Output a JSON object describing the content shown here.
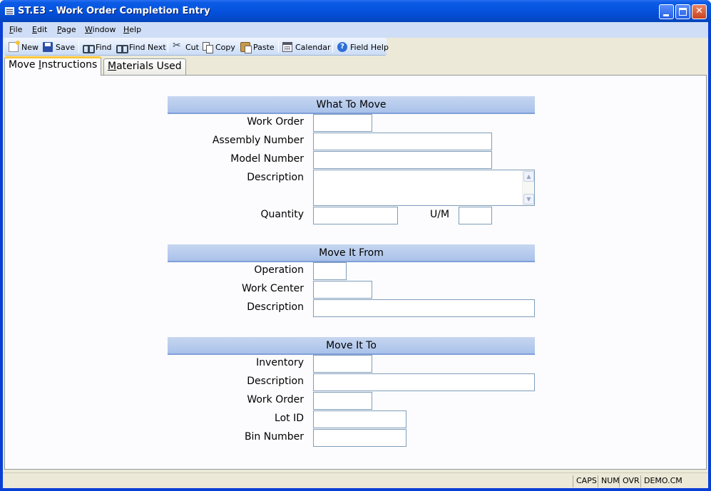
{
  "window": {
    "title": "ST.E3 - Work Order Completion Entry"
  },
  "menu": {
    "items": [
      "File",
      "Edit",
      "Page",
      "Window",
      "Help"
    ]
  },
  "toolbar": {
    "new": "New",
    "save": "Save",
    "find": "Find",
    "find_next": "Find Next",
    "cut": "Cut",
    "copy": "Copy",
    "paste": "Paste",
    "calendar": "Calendar",
    "field_help": "Field Help"
  },
  "tabs": {
    "move_instructions": {
      "pre": "Move ",
      "acc": "I",
      "post": "nstructions"
    },
    "materials_used": {
      "pre": "",
      "acc": "M",
      "post": "aterials Used"
    }
  },
  "what_to_move": {
    "header": "What To Move",
    "work_order": {
      "label": "Work Order",
      "value": ""
    },
    "assembly_number": {
      "label": "Assembly Number",
      "value": ""
    },
    "model_number": {
      "label": "Model Number",
      "value": ""
    },
    "description": {
      "label": "Description",
      "value": ""
    },
    "quantity": {
      "label": "Quantity",
      "value": ""
    },
    "um": {
      "label": "U/M",
      "value": ""
    }
  },
  "move_it_from": {
    "header": "Move It From",
    "operation": {
      "label": "Operation",
      "value": ""
    },
    "work_center": {
      "label": "Work Center",
      "value": ""
    },
    "description": {
      "label": "Description",
      "value": ""
    }
  },
  "move_it_to": {
    "header": "Move It To",
    "inventory": {
      "label": "Inventory",
      "value": ""
    },
    "description": {
      "label": "Description",
      "value": ""
    },
    "work_order": {
      "label": "Work Order",
      "value": ""
    },
    "lot_id": {
      "label": "Lot ID",
      "value": ""
    },
    "bin_number": {
      "label": "Bin Number",
      "value": ""
    }
  },
  "status": {
    "caps": "CAPS",
    "num": "NUM",
    "ovr": "OVR",
    "account": "DEMO.CM"
  },
  "icons": [
    "app-icon",
    "new-icon",
    "save-icon",
    "find-icon",
    "find-next-icon",
    "cut-icon",
    "copy-icon",
    "paste-icon",
    "calendar-icon",
    "help-icon"
  ],
  "colors": {
    "titlebar": "#0552dd",
    "section_header": "#b3c9ee",
    "active_tab_accent": "#ffc83c",
    "menubar": "#cfdef6"
  }
}
